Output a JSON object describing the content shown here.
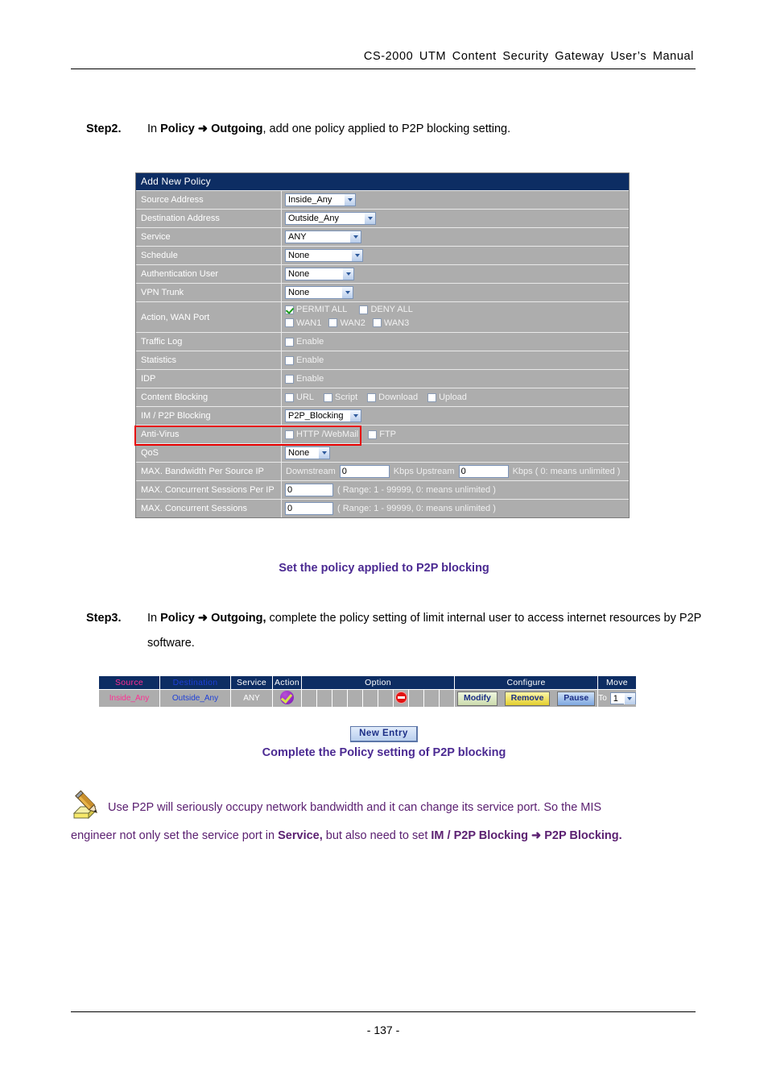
{
  "header": {
    "manual_title": "CS-2000  UTM  Content  Security  Gateway  User’s  Manual"
  },
  "step2": {
    "label": "Step2.",
    "text_before": "In ",
    "bold1": "Policy",
    "arrow": " ➜ ",
    "bold2": "Outgoing",
    "text_after": ", add one policy applied to P2P blocking setting."
  },
  "step3": {
    "label": "Step3.",
    "text_before": "In ",
    "bold1": "Policy",
    "arrow": " ➜ ",
    "bold2": "Outgoing,",
    "text_after": " complete the policy setting of limit internal user to access internet resources by P2P software."
  },
  "captions": {
    "caption1": "Set the policy applied to P2P blocking",
    "caption2": "Complete the Policy setting of P2P blocking"
  },
  "policy_form": {
    "title": "Add New Policy",
    "rows": {
      "source_address": {
        "label": "Source Address",
        "value": "Inside_Any"
      },
      "destination_address": {
        "label": "Destination Address",
        "value": "Outside_Any"
      },
      "service": {
        "label": "Service",
        "value": "ANY"
      },
      "schedule": {
        "label": "Schedule",
        "value": "None"
      },
      "authentication_user": {
        "label": "Authentication User",
        "value": "None"
      },
      "vpn_trunk": {
        "label": "VPN Trunk",
        "value": "None"
      },
      "action_wan_port": {
        "label": "Action, WAN Port",
        "permit_all": "PERMIT ALL",
        "deny_all": "DENY ALL",
        "wan1": "WAN1",
        "wan2": "WAN2",
        "wan3": "WAN3"
      },
      "traffic_log": {
        "label": "Traffic Log",
        "enable": "Enable"
      },
      "statistics": {
        "label": "Statistics",
        "enable": "Enable"
      },
      "idp": {
        "label": "IDP",
        "enable": "Enable"
      },
      "content_blocking": {
        "label": "Content Blocking",
        "url": "URL",
        "script": "Script",
        "download": "Download",
        "upload": "Upload"
      },
      "p2p_blocking": {
        "label": "IM / P2P Blocking",
        "value": "P2P_Blocking"
      },
      "anti_virus": {
        "label": "Anti-Virus",
        "http_webmail": "HTTP /WebMail",
        "ftp": "FTP"
      },
      "qos": {
        "label": "QoS",
        "value": "None"
      },
      "max_bandwidth": {
        "label": "MAX. Bandwidth Per Source IP",
        "downstream_label": "Downstream",
        "downstream_value": "0",
        "kbps_upstream_label": "Kbps Upstream",
        "upstream_value": "0",
        "kbps_note": "Kbps ( 0: means unlimited )"
      },
      "max_sessions_per_ip": {
        "label": "MAX. Concurrent Sessions Per IP",
        "value": "0",
        "note": "( Range: 1 - 99999, 0: means unlimited )"
      },
      "max_sessions": {
        "label": "MAX. Concurrent Sessions",
        "value": "0",
        "note": "( Range: 1 - 99999, 0: means unlimited )"
      }
    },
    "highlight_color": "#e60000"
  },
  "policy_list": {
    "columns": {
      "source": "Source",
      "destination": "Destination",
      "service": "Service",
      "action": "Action",
      "option": "Option",
      "configure": "Configure",
      "move": "Move"
    },
    "row": {
      "source": "Inside_Any",
      "destination": "Outside_Any",
      "service": "ANY",
      "action_icon": "permit-check-icon",
      "option_icon": "deny-circle-icon",
      "option_icon_index": 7,
      "option_cell_count": 10,
      "modify": "Modify",
      "remove": "Remove",
      "pause": "Pause",
      "move_to_label": "To",
      "move_value": "1"
    },
    "colors": {
      "header_bg": "#0d2d63",
      "cell_bg": "#adadad",
      "source_text": "#ff2d92",
      "destination_text": "#1c3fd8"
    }
  },
  "new_entry": {
    "label": "New  Entry"
  },
  "note": {
    "line1_a": "Use P2P will seriously occupy network bandwidth and it can change its service port. So the MIS",
    "line2_a": "engineer not only set the service port in ",
    "line2_b": "Service,",
    "line2_c": " but also need to set ",
    "line2_d": "IM / P2P Blocking",
    "line2_e": " ➜ ",
    "line2_f": "P2P Blocking."
  },
  "footer": {
    "page_number": "- 137 -"
  }
}
